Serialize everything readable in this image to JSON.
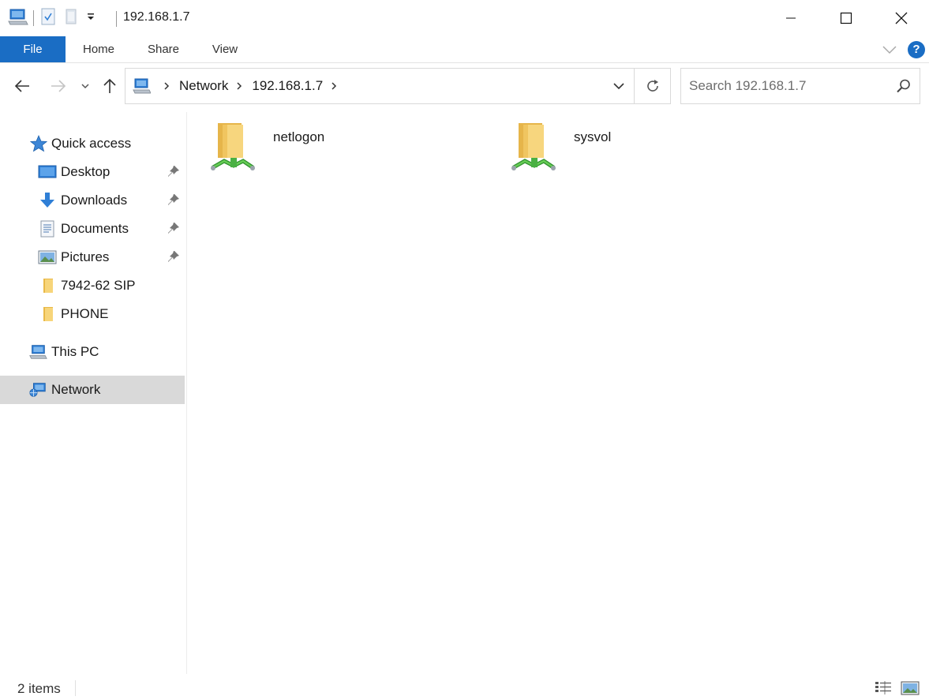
{
  "window": {
    "title": "192.168.1.7"
  },
  "ribbon": {
    "tabs": [
      {
        "label": "File"
      },
      {
        "label": "Home"
      },
      {
        "label": "Share"
      },
      {
        "label": "View"
      }
    ]
  },
  "address": {
    "crumbs": [
      {
        "label": "Network"
      },
      {
        "label": "192.168.1.7"
      }
    ]
  },
  "search": {
    "placeholder": "Search 192.168.1.7"
  },
  "navpane": {
    "quick_access": "Quick access",
    "pinned": [
      {
        "label": "Desktop",
        "icon": "desktop-icon"
      },
      {
        "label": "Downloads",
        "icon": "downloads-icon"
      },
      {
        "label": "Documents",
        "icon": "documents-icon"
      },
      {
        "label": "Pictures",
        "icon": "pictures-icon"
      }
    ],
    "recent": [
      {
        "label": "7942-62 SIP",
        "icon": "folder-icon"
      },
      {
        "label": "PHONE",
        "icon": "folder-icon"
      }
    ],
    "this_pc": "This PC",
    "network": "Network"
  },
  "content": {
    "items": [
      {
        "name": "netlogon",
        "icon": "shared-folder-icon"
      },
      {
        "name": "sysvol",
        "icon": "shared-folder-icon"
      }
    ]
  },
  "status": {
    "count": "2 items"
  },
  "colors": {
    "accent": "#1a6dc4",
    "selection": "#d9d9d9",
    "folder": "#f4d27a",
    "share_green": "#3aa33a"
  }
}
